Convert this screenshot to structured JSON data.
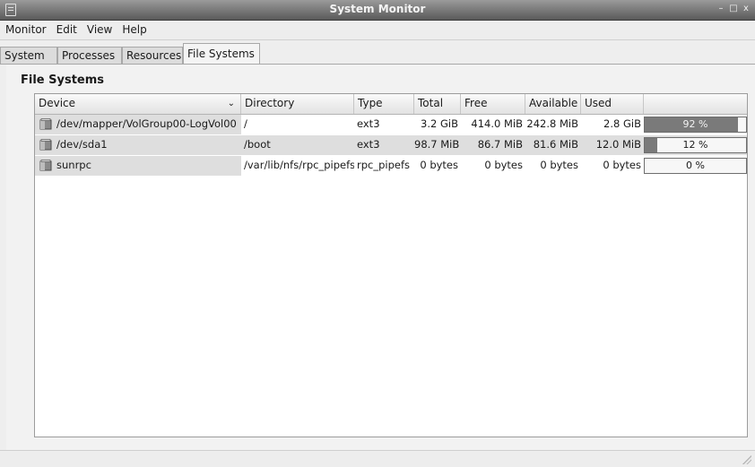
{
  "window": {
    "title": "System Monitor",
    "controls": [
      "–",
      "□",
      "x"
    ]
  },
  "menu": [
    "Monitor",
    "Edit",
    "View",
    "Help"
  ],
  "tabs": [
    {
      "label": "System",
      "active": false
    },
    {
      "label": "Processes",
      "active": false
    },
    {
      "label": "Resources",
      "active": false
    },
    {
      "label": "File Systems",
      "active": true
    }
  ],
  "section": {
    "heading": "File Systems"
  },
  "columns": [
    "Device",
    "Directory",
    "Type",
    "Total",
    "Free",
    "Available",
    "Used",
    ""
  ],
  "rows": [
    {
      "device": "/dev/mapper/VolGroup00-LogVol00",
      "directory": "/",
      "type": "ext3",
      "total": "3.2 GiB",
      "free": "414.0 MiB",
      "available": "242.8 MiB",
      "used": "2.8 GiB",
      "percent_label": "92 %",
      "percent": 0.92
    },
    {
      "device": "/dev/sda1",
      "directory": "/boot",
      "type": "ext3",
      "total": "98.7 MiB",
      "free": "86.7 MiB",
      "available": "81.6 MiB",
      "used": "12.0 MiB",
      "percent_label": "12 %",
      "percent": 0.12
    },
    {
      "device": "sunrpc",
      "directory": "/var/lib/nfs/rpc_pipefs",
      "type": "rpc_pipefs",
      "total": "0 bytes",
      "free": "0 bytes",
      "available": "0 bytes",
      "used": "0 bytes",
      "percent_label": "0 %",
      "percent": 0
    }
  ],
  "icons": {
    "device": "hard-disk-icon",
    "sort": "chevron-down-icon"
  },
  "colors": {
    "titlebar": "#5a5a5a",
    "usage_fill": "#7a7a7a"
  }
}
